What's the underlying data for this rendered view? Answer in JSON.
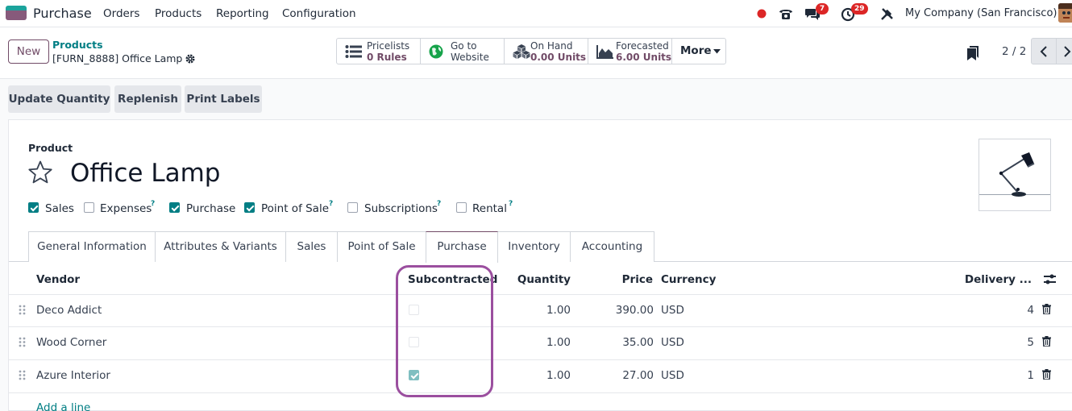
{
  "navbar": {
    "app_name": "Purchase",
    "menu": [
      "Orders",
      "Products",
      "Reporting",
      "Configuration"
    ],
    "messages_badge": "7",
    "activity_badge": "29",
    "company": "My Company (San Francisco)"
  },
  "control": {
    "new_label": "New",
    "breadcrumb_parent": "Products",
    "breadcrumb_current": "[FURN_8888] Office Lamp",
    "smart_buttons": [
      {
        "line1": "Pricelists",
        "line2": "0 Rules",
        "icon": "list-icon"
      },
      {
        "line1": "Go to",
        "line2": "Website",
        "icon": "globe-icon"
      },
      {
        "line1": "On Hand",
        "line2": "0.00 Units",
        "icon": "cubes-icon"
      },
      {
        "line1": "Forecasted",
        "line2": "6.00 Units",
        "icon": "area-chart-icon"
      }
    ],
    "more_label": "More",
    "pager": "2 / 2"
  },
  "actions": [
    "Update Quantity",
    "Replenish",
    "Print Labels"
  ],
  "form": {
    "field_label": "Product",
    "product_name": "Office Lamp",
    "flags": [
      {
        "label": "Sales",
        "checked": true,
        "help": ""
      },
      {
        "label": "Expenses",
        "checked": false,
        "help": "?"
      },
      {
        "label": "Purchase",
        "checked": true,
        "help": ""
      },
      {
        "label": "Point of Sale",
        "checked": true,
        "help": "?"
      },
      {
        "label": "Subscriptions",
        "checked": false,
        "help": "?"
      },
      {
        "label": "Rental",
        "checked": false,
        "help": "?"
      }
    ],
    "tabs": [
      "General Information",
      "Attributes & Variants",
      "Sales",
      "Point of Sale",
      "Purchase",
      "Inventory",
      "Accounting"
    ],
    "active_tab": "Purchase"
  },
  "table": {
    "headers": {
      "vendor": "Vendor",
      "subcontracted": "Subcontracted",
      "quantity": "Quantity",
      "price": "Price",
      "currency": "Currency",
      "delivery": "Delivery ..."
    },
    "rows": [
      {
        "vendor": "Deco Addict",
        "subcontracted": false,
        "quantity": "1.00",
        "price": "390.00",
        "currency": "USD",
        "delivery": "4"
      },
      {
        "vendor": "Wood Corner",
        "subcontracted": false,
        "quantity": "1.00",
        "price": "35.00",
        "currency": "USD",
        "delivery": "5"
      },
      {
        "vendor": "Azure Interior",
        "subcontracted": true,
        "quantity": "1.00",
        "price": "27.00",
        "currency": "USD",
        "delivery": "1"
      }
    ],
    "add_line": "Add a line"
  },
  "colors": {
    "brand": "#714b67",
    "accent": "#017e84",
    "highlight": "#9b4f9f",
    "badge": "#dc2626"
  }
}
